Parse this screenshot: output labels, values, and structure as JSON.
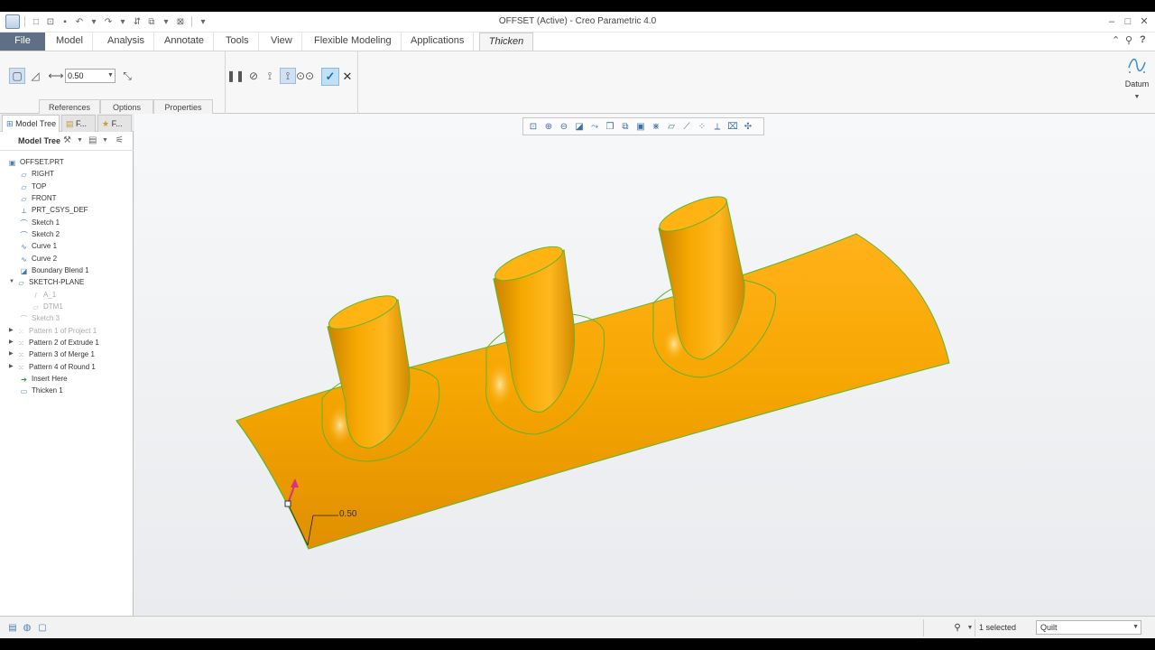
{
  "window": {
    "title": "OFFSET (Active) - Creo Parametric 4.0"
  },
  "tabs": [
    {
      "label": "File"
    },
    {
      "label": "Model"
    },
    {
      "label": "Analysis"
    },
    {
      "label": "Annotate"
    },
    {
      "label": "Tools"
    },
    {
      "label": "View"
    },
    {
      "label": "Flexible Modeling"
    },
    {
      "label": "Applications"
    },
    {
      "label": "Thicken"
    }
  ],
  "ribbon": {
    "thickness_value": "0.50",
    "panels": [
      {
        "label": "References"
      },
      {
        "label": "Options"
      },
      {
        "label": "Properties"
      }
    ],
    "datum_label": "Datum"
  },
  "left_panel": {
    "tabs": [
      {
        "label": "Model Tree"
      },
      {
        "label": "F..."
      },
      {
        "label": "F..."
      }
    ],
    "toolbar_label": "Model Tree",
    "tree": [
      {
        "label": "OFFSET.PRT",
        "icon": "part-icon"
      },
      {
        "label": "RIGHT",
        "icon": "datum-plane-icon"
      },
      {
        "label": "TOP",
        "icon": "datum-plane-icon"
      },
      {
        "label": "FRONT",
        "icon": "datum-plane-icon"
      },
      {
        "label": "PRT_CSYS_DEF",
        "icon": "csys-icon"
      },
      {
        "label": "Sketch 1",
        "icon": "sketch-icon"
      },
      {
        "label": "Sketch 2",
        "icon": "sketch-icon"
      },
      {
        "label": "Curve 1",
        "icon": "curve-icon"
      },
      {
        "label": "Curve 2",
        "icon": "curve-icon"
      },
      {
        "label": "Boundary Blend 1",
        "icon": "boundary-blend-icon"
      },
      {
        "label": "SKETCH-PLANE",
        "icon": "datum-plane-icon"
      },
      {
        "label": "A_1",
        "icon": "axis-icon"
      },
      {
        "label": "DTM1",
        "icon": "datum-plane-icon"
      },
      {
        "label": "Sketch 3",
        "icon": "sketch-icon"
      },
      {
        "label": "Pattern 1 of Project 1",
        "icon": "pattern-icon"
      },
      {
        "label": "Pattern 2 of Extrude 1",
        "icon": "pattern-icon"
      },
      {
        "label": "Pattern 3 of Merge 1",
        "icon": "pattern-icon"
      },
      {
        "label": "Pattern 4 of Round 1",
        "icon": "pattern-icon"
      },
      {
        "label": "Insert Here",
        "icon": "insert-arrow-icon"
      },
      {
        "label": "Thicken 1",
        "icon": "thicken-icon"
      }
    ]
  },
  "graphics": {
    "dimension_label": "0.50",
    "model_color": "#f5a800",
    "edge_color": "#5fb52c"
  },
  "status": {
    "selected_text": "1 selected",
    "filter_value": "Quilt"
  }
}
